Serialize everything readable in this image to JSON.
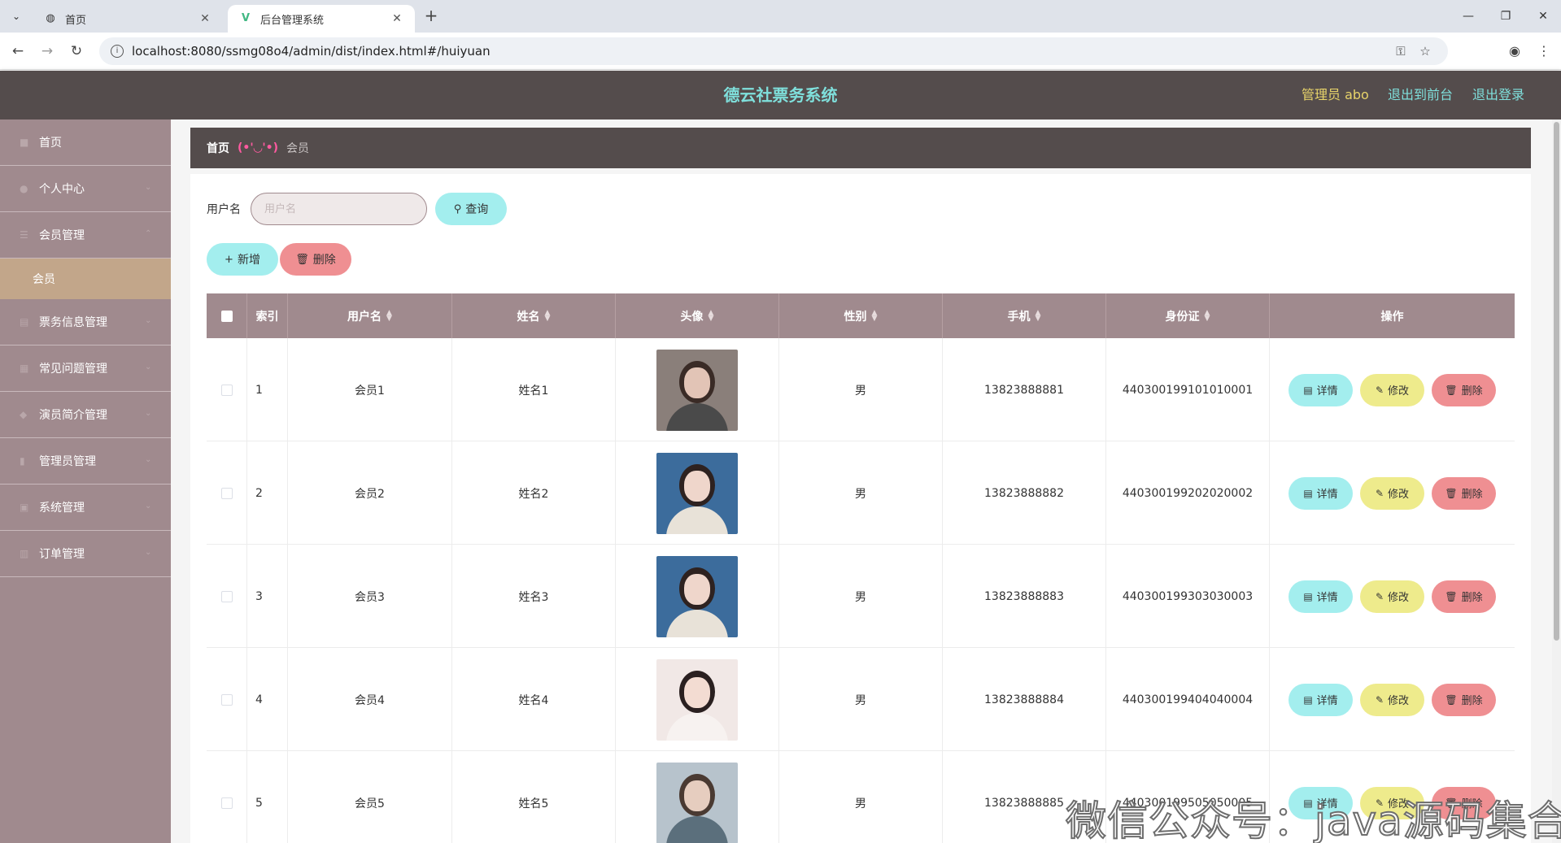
{
  "browser": {
    "tabs": [
      {
        "title": "首页",
        "icon": "globe-icon"
      },
      {
        "title": "后台管理系统",
        "icon": "vue-logo-icon"
      }
    ],
    "url": "localhost:8080/ssmg08o4/admin/dist/index.html#/huiyuan"
  },
  "header": {
    "title": "德云社票务系统",
    "admin_label": "管理员 abo",
    "front_label": "退出到前台",
    "logout_label": "退出登录",
    "colors": {
      "title": "#7fe0dc",
      "admin": "#e8d46a",
      "links": "#7fe0dc",
      "bar": "#544c4c"
    }
  },
  "sidebar": {
    "items": [
      {
        "label": "首页"
      },
      {
        "label": "个人中心"
      },
      {
        "label": "会员管理"
      },
      {
        "label": "会员",
        "sub": true
      },
      {
        "label": "票务信息管理"
      },
      {
        "label": "常见问题管理"
      },
      {
        "label": "演员简介管理"
      },
      {
        "label": "管理员管理"
      },
      {
        "label": "系统管理"
      },
      {
        "label": "订单管理"
      }
    ]
  },
  "breadcrumb": {
    "home": "首页",
    "separator": "(•'◡'•)",
    "current": "会员"
  },
  "search": {
    "label": "用户名",
    "placeholder": "用户名",
    "value": "",
    "button": "查询"
  },
  "actions": {
    "add": "新增",
    "delete": "删除"
  },
  "table": {
    "headers": [
      "索引",
      "用户名",
      "姓名",
      "头像",
      "性别",
      "手机",
      "身份证",
      "操作"
    ],
    "rows": [
      {
        "index": "1",
        "username": "会员1",
        "name": "姓名1",
        "gender": "男",
        "phone": "13823888881",
        "id_card": "440300199101010001"
      },
      {
        "index": "2",
        "username": "会员2",
        "name": "姓名2",
        "gender": "男",
        "phone": "13823888882",
        "id_card": "440300199202020002"
      },
      {
        "index": "3",
        "username": "会员3",
        "name": "姓名3",
        "gender": "男",
        "phone": "13823888883",
        "id_card": "440300199303030003"
      },
      {
        "index": "4",
        "username": "会员4",
        "name": "姓名4",
        "gender": "男",
        "phone": "13823888884",
        "id_card": "440300199404040004"
      },
      {
        "index": "5",
        "username": "会员5",
        "name": "姓名5",
        "gender": "男",
        "phone": "13823888885",
        "id_card": "440300199505050005"
      }
    ],
    "row_actions": {
      "detail": "详情",
      "edit": "修改",
      "delete": "删除"
    }
  },
  "watermark": "微信公众号：java源码集合"
}
